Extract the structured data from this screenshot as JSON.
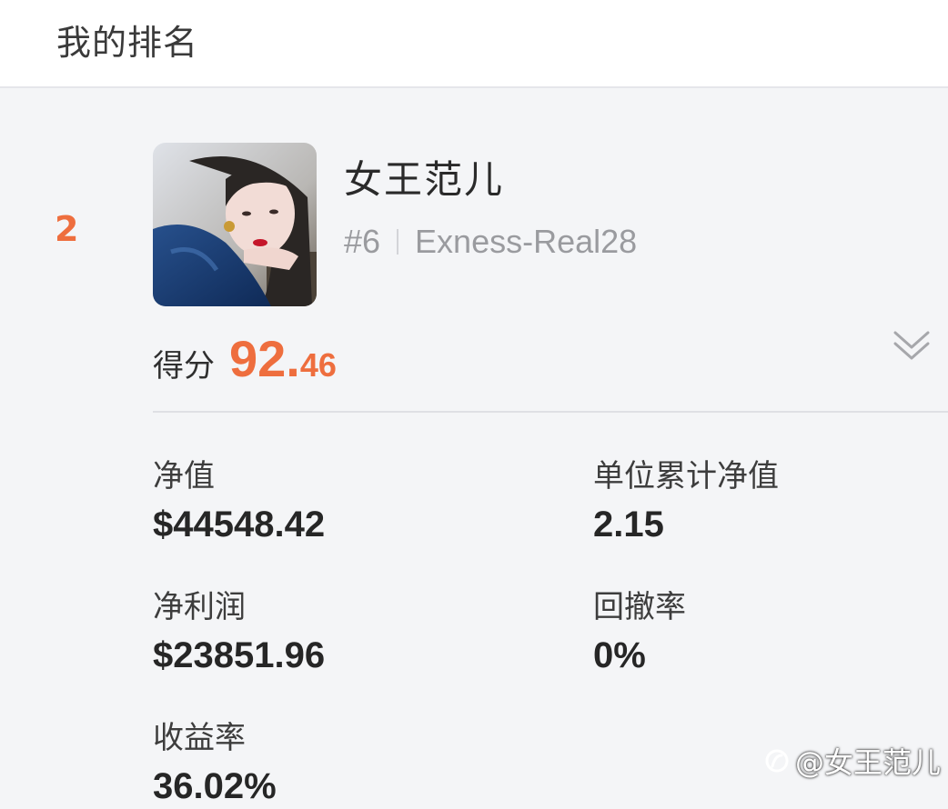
{
  "header": {
    "title": "我的排名"
  },
  "entry": {
    "rank": "2",
    "avatar_icon": "user-avatar-photo",
    "name": "女王范儿",
    "account_no": "#6",
    "server": "Exness-Real28",
    "score_label": "得分",
    "score_int": "92.",
    "score_dec": "46",
    "expand_icon": "double-chevron-down-icon"
  },
  "stats": [
    {
      "label": "净值",
      "value": "$44548.42"
    },
    {
      "label": "单位累计净值",
      "value": "2.15"
    },
    {
      "label": "净利润",
      "value": "$23851.96"
    },
    {
      "label": "回撤率",
      "value": "0%"
    },
    {
      "label": "收益率",
      "value": "36.02%"
    }
  ],
  "watermark": {
    "text": "@女王范儿"
  },
  "colors": {
    "accent": "#ee6e3e",
    "background": "#f4f5f7",
    "muted": "#9a9b9f"
  }
}
